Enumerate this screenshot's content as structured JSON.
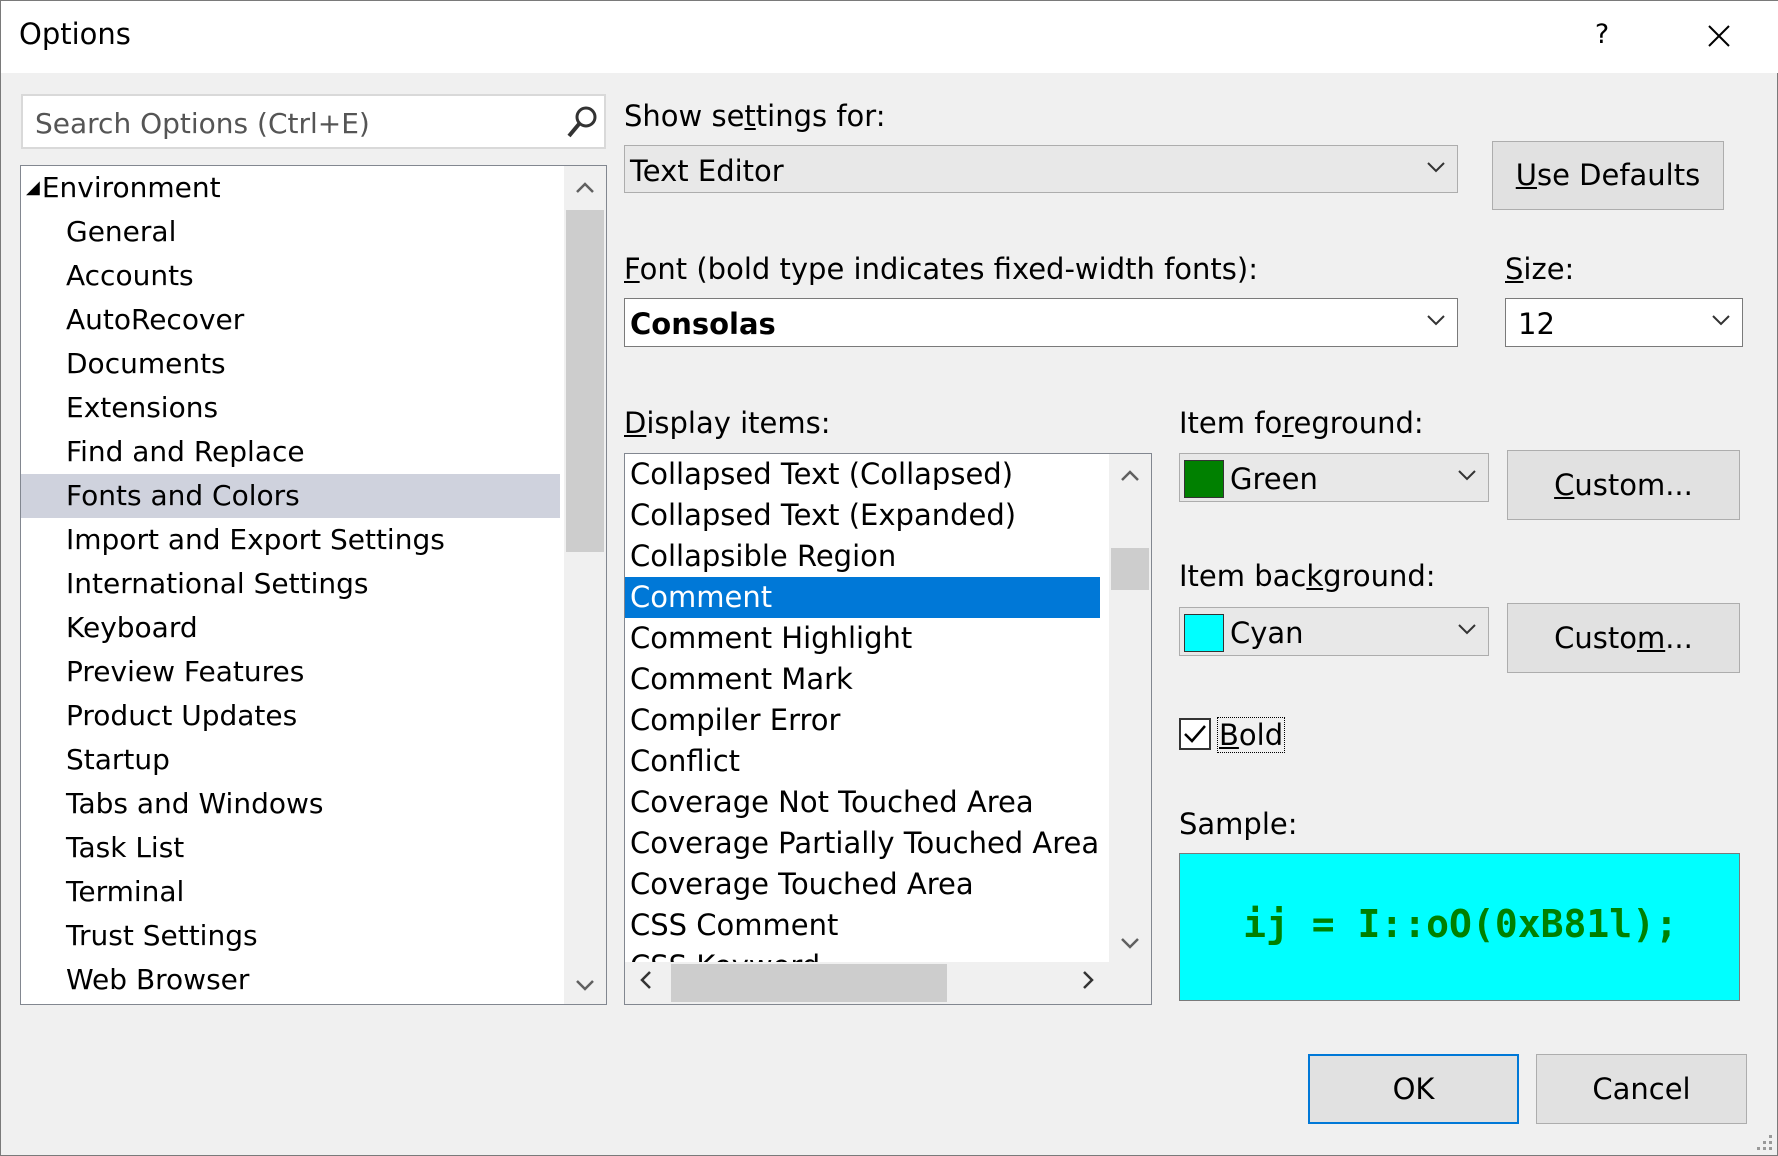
{
  "window": {
    "title": "Options",
    "help_label": "?",
    "close_label": "✕"
  },
  "search": {
    "placeholder": "Search Options (Ctrl+E)"
  },
  "tree": {
    "root": "Environment",
    "items": [
      "General",
      "Accounts",
      "AutoRecover",
      "Documents",
      "Extensions",
      "Find and Replace",
      "Fonts and Colors",
      "Import and Export Settings",
      "International Settings",
      "Keyboard",
      "Preview Features",
      "Product Updates",
      "Startup",
      "Tabs and Windows",
      "Task List",
      "Terminal",
      "Trust Settings",
      "Web Browser"
    ],
    "selected": "Fonts and Colors"
  },
  "show_settings": {
    "label_pre": "Show se",
    "label_key": "t",
    "label_post": "tings for:",
    "value": "Text Editor"
  },
  "use_defaults": {
    "key": "U",
    "rest": "se Defaults"
  },
  "font": {
    "label_key": "F",
    "label_rest": "ont (bold type indicates fixed-width fonts):",
    "value": "Consolas"
  },
  "size": {
    "label_key": "S",
    "label_rest": "ize:",
    "value": "12"
  },
  "display_items": {
    "label_key": "D",
    "label_rest": "isplay items:",
    "items": [
      "Collapsed Text (Collapsed)",
      "Collapsed Text (Expanded)",
      "Collapsible Region",
      "Comment",
      "Comment Highlight",
      "Comment Mark",
      "Compiler Error",
      "Conflict",
      "Coverage Not Touched Area",
      "Coverage Partially Touched Area",
      "Coverage Touched Area",
      "CSS Comment",
      "CSS Keyword"
    ],
    "selected": "Comment"
  },
  "foreground": {
    "label_pre": "Item fo",
    "label_key": "r",
    "label_post": "eground:",
    "value": "Green",
    "color": "#008000",
    "custom_key": "C",
    "custom_rest": "ustom..."
  },
  "background": {
    "label_pre": "Item bac",
    "label_key": "k",
    "label_post": "ground:",
    "value": "Cyan",
    "color": "#00ffff",
    "custom_pre": "Custo",
    "custom_key": "m",
    "custom_post": "..."
  },
  "bold": {
    "label_key": "B",
    "label_rest": "old",
    "checked": true
  },
  "sample": {
    "label": "Sample:",
    "text": "ij = I::oO(0xB81l);"
  },
  "buttons": {
    "ok": "OK",
    "cancel": "Cancel"
  },
  "colors": {
    "selection": "#0078d7",
    "tree_selection": "#cfd2dd"
  }
}
